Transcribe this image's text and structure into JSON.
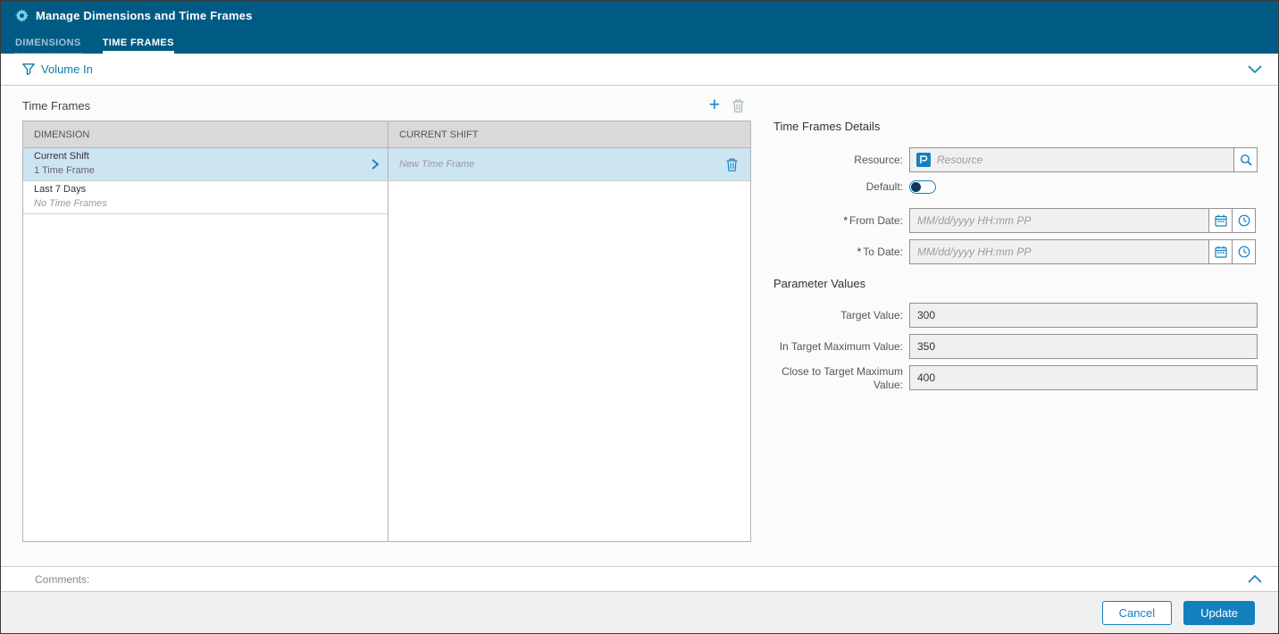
{
  "colors": {
    "header_bg": "#005B84",
    "accent": "#1380BE",
    "selected_row": "#CDE4F3",
    "link": "#0A7CA3"
  },
  "header": {
    "title": "Manage Dimensions and Time Frames",
    "tabs": [
      {
        "id": "dimensions",
        "label": "DIMENSIONS"
      },
      {
        "id": "time-frames",
        "label": "TIME FRAMES"
      }
    ]
  },
  "filter_bar": {
    "label": "Volume In"
  },
  "time_frames": {
    "title": "Time Frames",
    "columns": {
      "dimension": "DIMENSION",
      "current": "CURRENT SHIFT"
    },
    "rows": [
      {
        "name": "Current Shift",
        "sub": "1 Time Frame",
        "selected": true
      },
      {
        "name": "Last 7 Days",
        "sub": "No Time Frames",
        "selected": false
      }
    ],
    "frames": [
      {
        "label": "New Time Frame"
      }
    ]
  },
  "details": {
    "title": "Time Frames Details",
    "resource": {
      "label": "Resource:",
      "placeholder": "Resource"
    },
    "default": {
      "label": "Default:"
    },
    "from_date": {
      "required": "*",
      "label": "From Date:",
      "placeholder": "MM/dd/yyyy HH:mm PP"
    },
    "to_date": {
      "required": "*",
      "label": "To Date:",
      "placeholder": "MM/dd/yyyy HH:mm PP"
    }
  },
  "parameters": {
    "title": "Parameter Values",
    "fields": [
      {
        "label": "Target Value:",
        "value": "300"
      },
      {
        "label": "In Target Maximum Value:",
        "value": "350"
      },
      {
        "label": "Close to Target Maximum Value:",
        "value": "400"
      }
    ]
  },
  "comments": {
    "label": "Comments:"
  },
  "footer": {
    "cancel": "Cancel",
    "update": "Update"
  }
}
